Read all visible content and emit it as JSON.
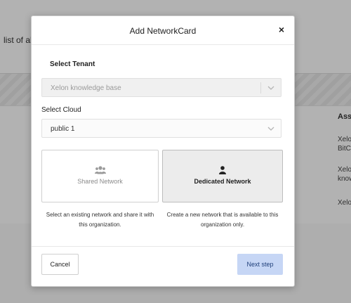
{
  "background": {
    "description_fragment": "list of al",
    "table": {
      "column_header": "Assi",
      "cells": [
        "Xelo",
        "BitCo",
        "Xelo",
        "know",
        "Xelo"
      ]
    }
  },
  "modal": {
    "title": "Add NetworkCard",
    "close_symbol": "×",
    "tenant": {
      "label": "Select Tenant",
      "value": "Xelon knowledge base",
      "disabled": true
    },
    "cloud": {
      "label": "Select Cloud",
      "value": "public 1"
    },
    "network_options": [
      {
        "id": "shared",
        "label": "Shared Network",
        "icon": "users-icon",
        "selected": false,
        "description": "Select an existing network and share it with this organization."
      },
      {
        "id": "dedicated",
        "label": "Dedicated Network",
        "icon": "user-icon",
        "selected": true,
        "description": "Create a new network that is available to this organization only."
      }
    ],
    "buttons": {
      "cancel": "Cancel",
      "next": "Next step"
    }
  },
  "colors": {
    "primary_button_bg": "#c6d6f5",
    "selected_card_bg": "#ececec",
    "overlay": "rgba(0,0,0,0.30)"
  }
}
